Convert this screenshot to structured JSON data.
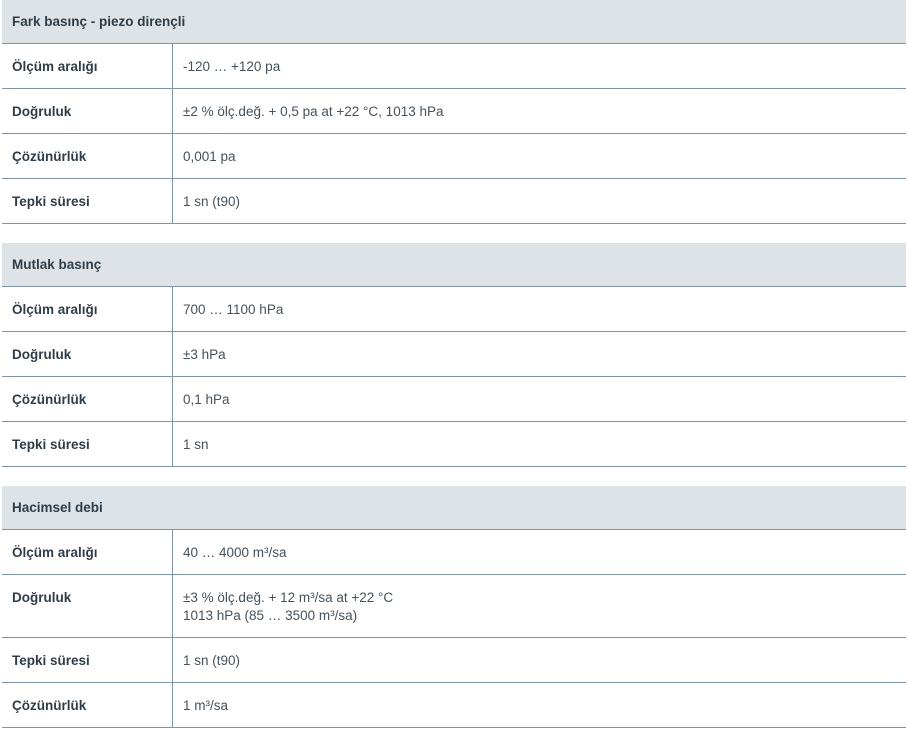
{
  "sections": [
    {
      "title": "Fark basınç - piezo dirençli",
      "rows": [
        {
          "label": "Ölçüm aralığı",
          "value": "-120 … +120 pa"
        },
        {
          "label": "Doğruluk",
          "value": "±2 % ölç.değ. + 0,5 pa at +22 °C, 1013 hPa"
        },
        {
          "label": "Çözünürlük",
          "value": "0,001 pa"
        },
        {
          "label": "Tepki süresi",
          "value": "1 sn (t90)"
        }
      ]
    },
    {
      "title": "Mutlak basınç",
      "rows": [
        {
          "label": "Ölçüm aralığı",
          "value": "700 … 1100 hPa"
        },
        {
          "label": "Doğruluk",
          "value": "±3 hPa"
        },
        {
          "label": "Çözünürlük",
          "value": "0,1 hPa"
        },
        {
          "label": "Tepki süresi",
          "value": "1 sn"
        }
      ]
    },
    {
      "title": "Hacimsel debi",
      "rows": [
        {
          "label": "Ölçüm aralığı",
          "value": "40 … 4000 m³/sa"
        },
        {
          "label": "Doğruluk",
          "value_line1": "±3 % ölç.değ. + 12 m³/sa at +22 °C",
          "value_line2": "1013 hPa (85 … 3500 m³/sa)"
        },
        {
          "label": "Tepki süresi",
          "value": "1 sn (t90)"
        },
        {
          "label": "Çözünürlük",
          "value": "1 m³/sa"
        }
      ]
    }
  ]
}
